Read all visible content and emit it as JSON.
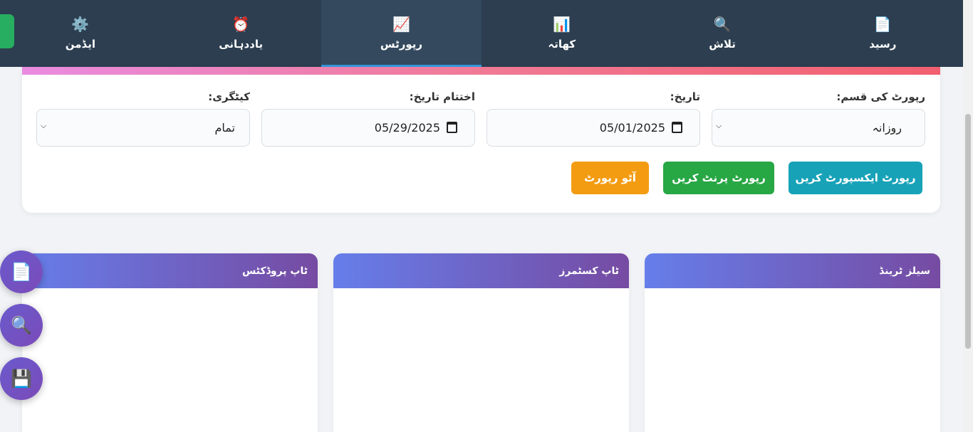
{
  "nav": {
    "items": [
      {
        "label": "رسید",
        "icon": "📄",
        "name": "nav-receipt"
      },
      {
        "label": "تلاش",
        "icon": "🔍",
        "name": "nav-search"
      },
      {
        "label": "کھاتہ",
        "icon": "📊",
        "name": "nav-ledger"
      },
      {
        "label": "رپورٹس",
        "icon": "📈",
        "name": "nav-reports"
      },
      {
        "label": "یاددہانی",
        "icon": "⏰",
        "name": "nav-reminders"
      },
      {
        "label": "ایڈمن",
        "icon": "⚙️",
        "name": "nav-admin"
      }
    ],
    "active": "رپورٹس",
    "active_color": "#3498db"
  },
  "filters": {
    "report_type": {
      "label": "رپورٹ کی قسم:",
      "value": "روزانہ"
    },
    "date": {
      "label": "تاریخ:",
      "value": "05/01/2025"
    },
    "end_date": {
      "label": "اختتام تاریخ:",
      "value": "05/29/2025"
    },
    "category": {
      "label": "کیٹگری:",
      "value": "تمام"
    }
  },
  "actions": {
    "export": "رپورٹ ایکسپورٹ کریں",
    "print": "رپورٹ پرنٹ کریں",
    "auto": "آٹو رپورٹ"
  },
  "panels": {
    "sales_trend": "سیلز ٹرینڈ",
    "top_customers": "ٹاپ کسٹمرز",
    "top_products": "ٹاپ پروڈکٹس"
  },
  "fabs": {
    "receipt_icon": "📄",
    "search_icon": "🔍",
    "save_icon": "💾"
  },
  "colors": {
    "nav_bg": "#2c3e50",
    "export_btn": "#17a2b8",
    "print_btn": "#28a745",
    "auto_btn": "#f39c12"
  }
}
